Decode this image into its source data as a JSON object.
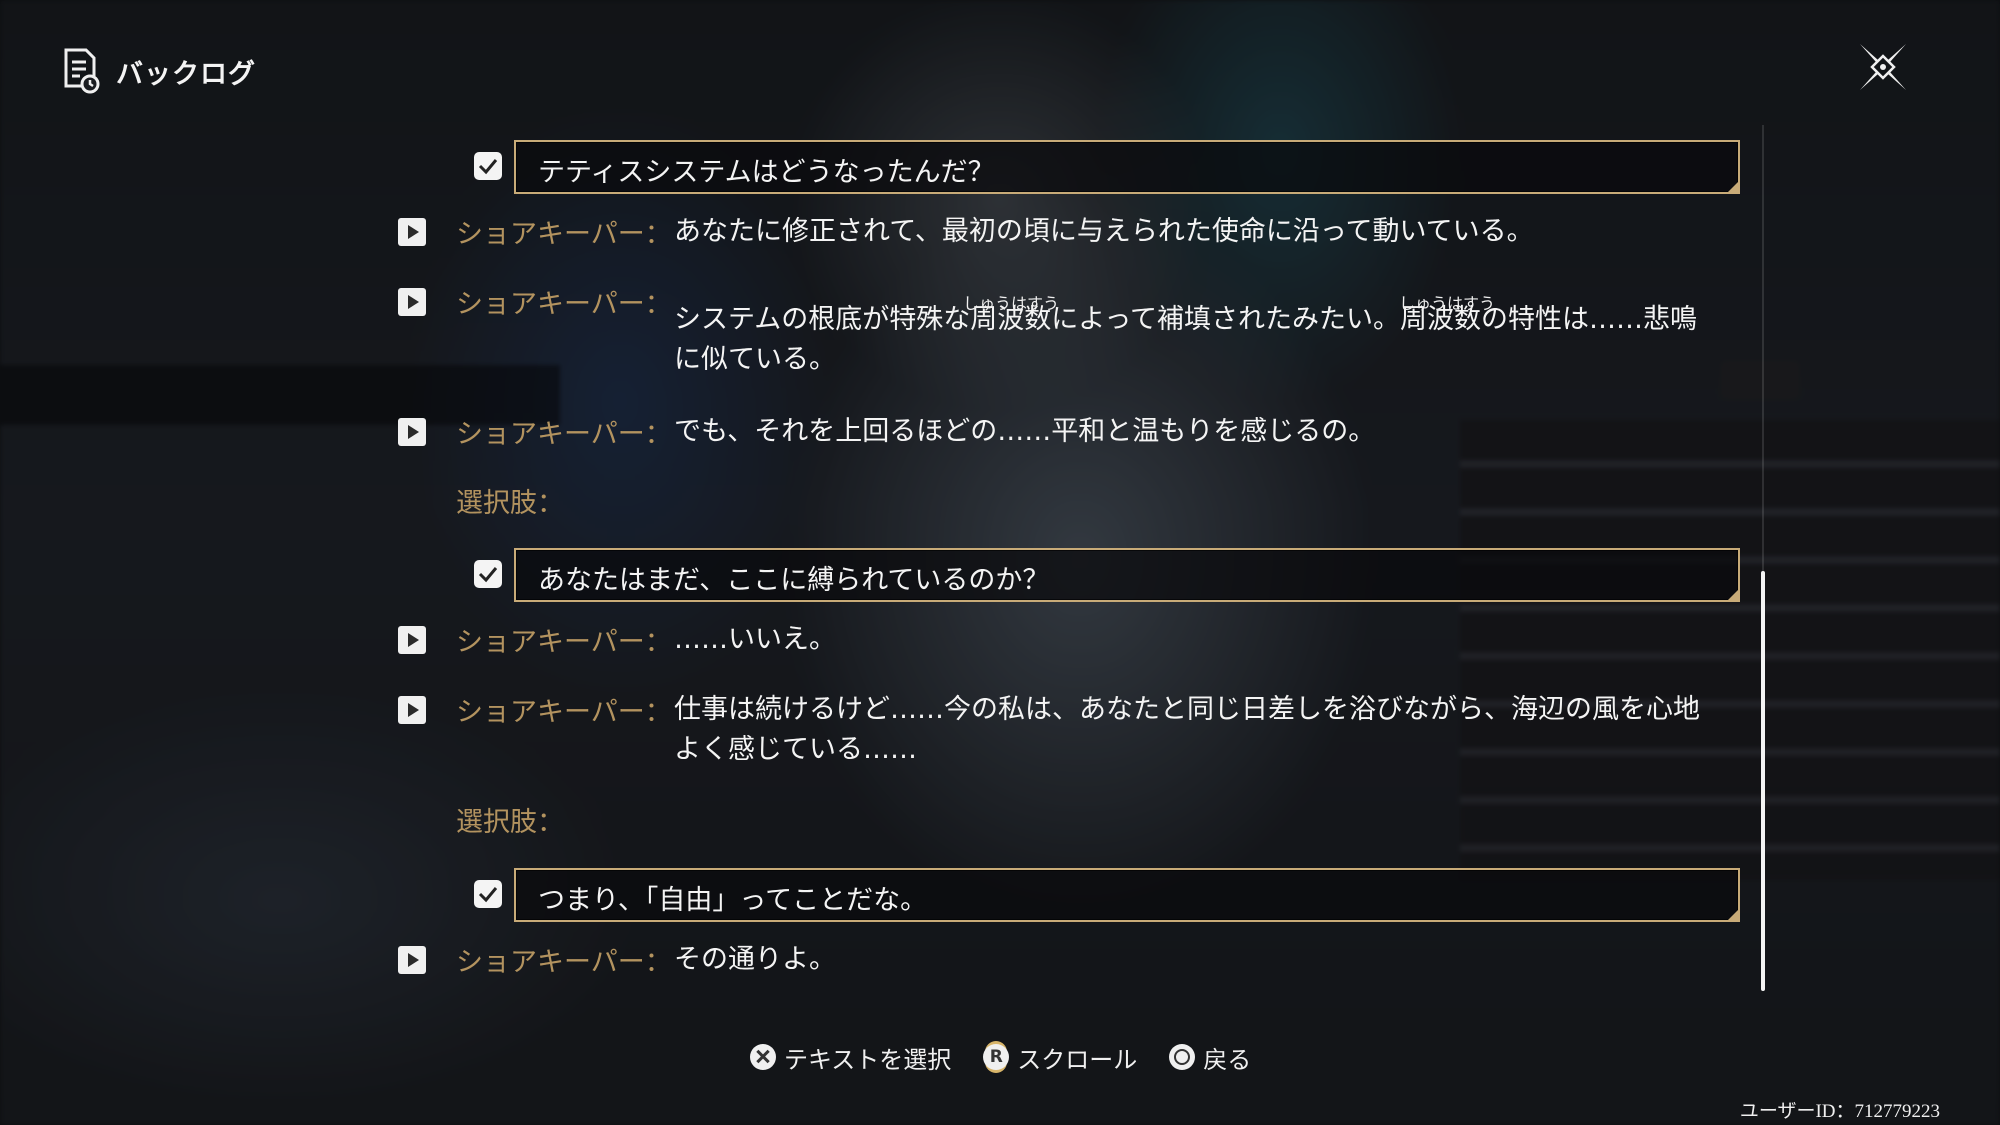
{
  "header": {
    "title": "バックログ",
    "icon": "backlog-document-icon"
  },
  "close": {
    "icon": "close-x-icon"
  },
  "log": {
    "choice1": "テティスシステムはどうなったんだ？",
    "line1": {
      "speaker": "ショアキーパー：",
      "text": "あなたに修正されて、最初の頃に与えられた使命に沿って動いている。"
    },
    "line2": {
      "speaker": "ショアキーパー：",
      "text_a": "システムの根底が特殊な周波数によって補填されたみたい。周波数の特性は……悲鳴",
      "text_b": "に似ている。",
      "ruby1": "しゅうはすう",
      "ruby2": "しゅうはすう"
    },
    "line3": {
      "speaker": "ショアキーパー：",
      "text": "でも、それを上回るほどの……平和と温もりを感じるの。"
    },
    "label1": "選択肢：",
    "choice2": "あなたはまだ、ここに縛られているのか？",
    "line4": {
      "speaker": "ショアキーパー：",
      "text": "……いいえ。"
    },
    "line5": {
      "speaker": "ショアキーパー：",
      "text_a": "仕事は続けるけど……今の私は、あなたと同じ日差しを浴びながら、海辺の風を心地",
      "text_b": "よく感じている……"
    },
    "label2": "選択肢：",
    "choice3": "つまり、「自由」ってことだな。",
    "line6": {
      "speaker": "ショアキーパー：",
      "text": "その通りよ。"
    }
  },
  "footer": {
    "select_label": "テキストを選択",
    "scroll_label": "スクロール",
    "scroll_button": "R",
    "back_label": "戻る",
    "user_id": "ユーザーID：712779223"
  },
  "colors": {
    "speaker": "#b3935f",
    "choice_border": "#c8ab78",
    "text": "#f4f4f4"
  }
}
